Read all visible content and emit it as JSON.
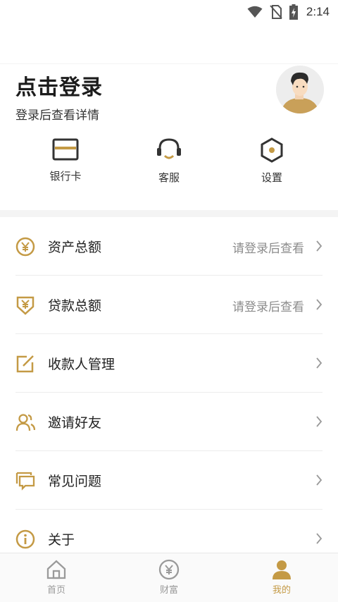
{
  "status": {
    "time": "2:14",
    "icons": [
      "wifi-icon",
      "no-sim-icon",
      "battery-charging-icon"
    ]
  },
  "header": {
    "title": "点击登录",
    "subtitle": "登录后查看详情",
    "avatar": "avatar-illustration"
  },
  "quick_actions": [
    {
      "label": "银行卡",
      "icon": "bank-card-icon"
    },
    {
      "label": "客服",
      "icon": "headset-icon"
    },
    {
      "label": "设置",
      "icon": "settings-hexagon-icon"
    }
  ],
  "menu": [
    {
      "label": "资产总额",
      "hint": "请登录后查看",
      "icon": "yen-circle-icon"
    },
    {
      "label": "贷款总额",
      "hint": "请登录后查看",
      "icon": "yen-shield-icon"
    },
    {
      "label": "收款人管理",
      "hint": "",
      "icon": "edit-square-icon"
    },
    {
      "label": "邀请好友",
      "hint": "",
      "icon": "users-icon"
    },
    {
      "label": "常见问题",
      "hint": "",
      "icon": "chat-bubbles-icon"
    },
    {
      "label": "关于",
      "hint": "",
      "icon": "info-circle-icon"
    }
  ],
  "tabbar": [
    {
      "label": "首页",
      "icon": "home-icon",
      "active": false
    },
    {
      "label": "财富",
      "icon": "yen-coin-icon",
      "active": false
    },
    {
      "label": "我的",
      "icon": "person-icon",
      "active": true
    }
  ],
  "colors": {
    "accent": "#c49a45",
    "text": "#222222",
    "muted": "#8c8c8c",
    "band": "#f4f4f4"
  }
}
